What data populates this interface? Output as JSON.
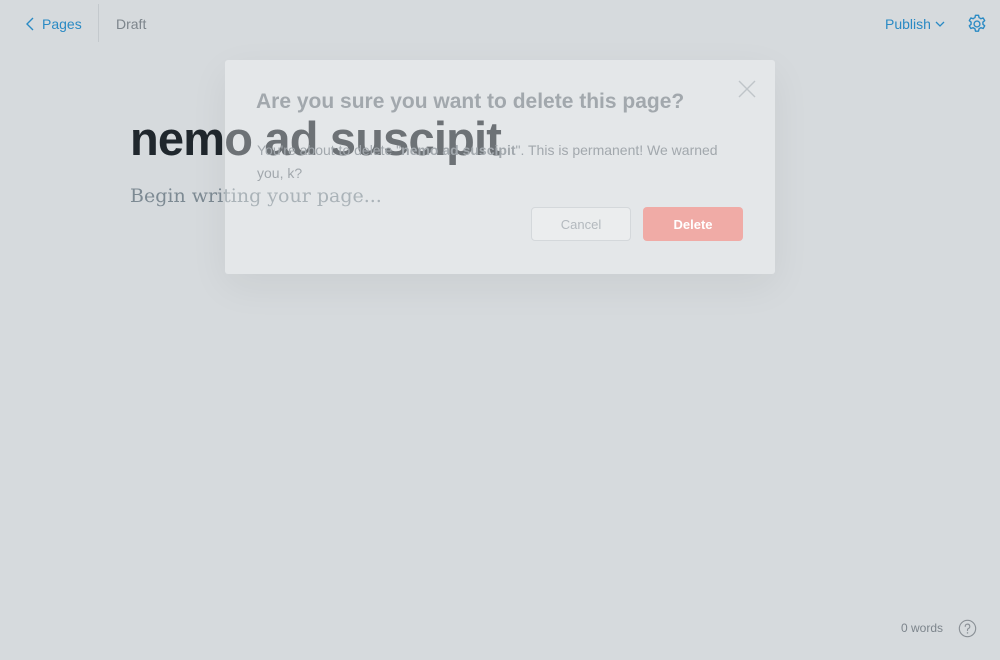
{
  "topbar": {
    "back_label": "Pages",
    "status": "Draft",
    "publish_label": "Publish"
  },
  "editor": {
    "title": "nemo ad suscipit",
    "body_placeholder": "Begin writing your page..."
  },
  "footer": {
    "word_count": "0 words"
  },
  "modal": {
    "title": "Are you sure you want to delete this page?",
    "body_prefix": "You're about to delete \"",
    "page_name": "nemo ad suscipit",
    "body_suffix": "\". This is permanent! We warned you, k?",
    "cancel_label": "Cancel",
    "delete_label": "Delete"
  },
  "colors": {
    "accent": "#2a8ac4",
    "danger": "#f0aba6",
    "background": "#d6dadd"
  },
  "icons": [
    "chevron-left-icon",
    "chevron-down-icon",
    "gear-icon",
    "question-icon",
    "close-icon"
  ]
}
